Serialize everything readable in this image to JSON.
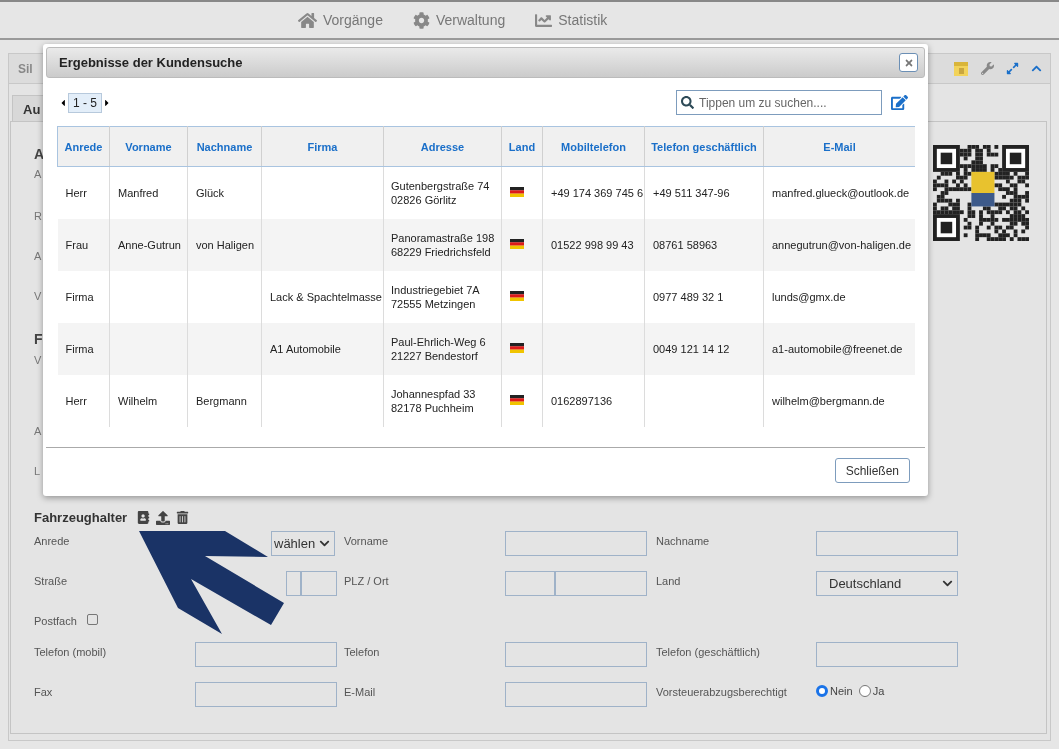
{
  "nav": [
    {
      "label": "Vorgänge",
      "kind": "home"
    },
    {
      "label": "Verwaltung",
      "kind": "settings"
    },
    {
      "label": "Statistik",
      "kind": "chart"
    }
  ],
  "panel": {
    "title": "Sil",
    "tab": "Au",
    "fragments": [
      {
        "text": "A",
        "kind": "heading"
      },
      {
        "text": "A",
        "kind": "label"
      },
      {
        "text": "R",
        "kind": "label"
      },
      {
        "text": "A",
        "kind": "label"
      },
      {
        "text": "V",
        "kind": "label"
      },
      {
        "text": "F",
        "kind": "heading"
      },
      {
        "text": "V",
        "kind": "label"
      },
      {
        "text": "A",
        "kind": "label"
      },
      {
        "text": "L",
        "kind": "label"
      }
    ]
  },
  "dialog": {
    "title": "Ergebnisse der Kundensuche",
    "pager": "1 - 5",
    "search": {
      "placeholder": "Tippen um zu suchen...."
    },
    "columns": [
      "Anrede",
      "Vorname",
      "Nachname",
      "Firma",
      "Adresse",
      "Land",
      "Mobiltelefon",
      "Telefon geschäftlich",
      "E-Mail"
    ],
    "rows": [
      {
        "salutation": "Herr",
        "first_name": "Manfred",
        "last_name": "Glück",
        "company": "",
        "address": [
          "Gutenbergstraße 74",
          "02826 Görlitz"
        ],
        "mobile": "+49 174 369 745 6",
        "business_phone": "+49 511 347-96",
        "email": "manfred.glueck@outlook.de"
      },
      {
        "salutation": "Frau",
        "first_name": "Anne-Gutrun",
        "last_name": "von Haligen",
        "company": "",
        "address": [
          "Panoramastraße 198",
          "68229  Friedrichsfeld"
        ],
        "mobile": "01522 998 99 43",
        "business_phone": "08761 58963",
        "email": "annegutrun@von-haligen.de"
      },
      {
        "salutation": "Firma",
        "first_name": "",
        "last_name": "",
        "company": "Lack & Spachtelmasse",
        "address": [
          "Industriegebiet 7A",
          "72555 Metzingen"
        ],
        "mobile": "",
        "business_phone": "0977 489 32 1",
        "email": "lunds@gmx.de"
      },
      {
        "salutation": "Firma",
        "first_name": "",
        "last_name": "",
        "company": "A1 Automobile",
        "address": [
          "Paul-Ehrlich-Weg 6",
          "21227 Bendestorf"
        ],
        "mobile": "",
        "business_phone": "0049 121 14 12",
        "email": "a1-automobile@freenet.de"
      },
      {
        "salutation": "Herr",
        "first_name": "Wilhelm",
        "last_name": "Bergmann",
        "company": "",
        "address": [
          "Johannespfad 33",
          "82178 Puchheim"
        ],
        "mobile": "0162897136",
        "business_phone": "",
        "email": "wilhelm@bergmann.de"
      }
    ],
    "close_button": "Schließen"
  },
  "owner": {
    "title": "Fahrzeughalter",
    "rows": [
      [
        {
          "label": "Anrede",
          "kind": "select",
          "value": "wählen"
        },
        {
          "label": "Vorname",
          "kind": "input"
        },
        {
          "label": "Nachname",
          "kind": "input"
        }
      ],
      [
        {
          "label": "Straße",
          "kind": "street"
        },
        {
          "label": "PLZ / Ort",
          "kind": "zip-city"
        },
        {
          "label": "Land",
          "kind": "select",
          "value": "Deutschland"
        }
      ],
      [
        {
          "label": "Postfach",
          "kind": "checkbox",
          "checked": false
        }
      ],
      [
        {
          "label": "Telefon (mobil)",
          "kind": "input"
        },
        {
          "label": "Telefon",
          "kind": "input"
        },
        {
          "label": "Telefon (geschäftlich)",
          "kind": "input"
        }
      ],
      [
        {
          "label": "Fax",
          "kind": "input"
        },
        {
          "label": "E-Mail",
          "kind": "input"
        },
        {
          "label": "Vorsteuerabzugsberechtigt",
          "kind": "radio",
          "options": [
            {
              "label": "Nein",
              "selected": true
            },
            {
              "label": "Ja",
              "selected": false
            }
          ]
        }
      ]
    ]
  }
}
